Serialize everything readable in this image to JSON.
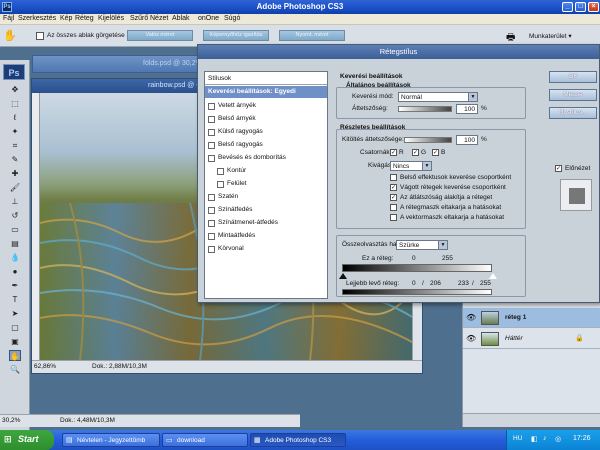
{
  "window": {
    "title": "Adobe Photoshop CS3",
    "app_badge": "Ps"
  },
  "menu": [
    "Fájl",
    "Szerkesztés",
    "Kép",
    "Réteg",
    "Kijelölés",
    "Szűrő",
    "Nézet",
    "Ablak",
    "onOne",
    "Súgó"
  ],
  "options": {
    "scroll_all_label": "Az összes ablak görgetése",
    "btn1": "Valós méret",
    "btn2": "Képernyőhöz igazítás",
    "btn3": "Nyomt. méret",
    "workspace": "Munkaterület ▾"
  },
  "documents": {
    "back_title": "földs.psd @ 30,2%",
    "front_title": "rainbow.psd @ 62,9%",
    "front_zoom": "62,86%",
    "front_dok": "Dok.: 2,88M/10,3M",
    "back_zoom": "30,2%",
    "back_dok": "Dok.: 4,48M/10,3M"
  },
  "dialog": {
    "title": "Rétegstílus",
    "list_header": "Stílusok",
    "list_selected": "Keverési beállítások: Egyedi",
    "styles": [
      "Vetett árnyék",
      "Belső árnyék",
      "Külső ragyogás",
      "Belső ragyogás",
      "Bevésés és domborítás",
      "Kontúr",
      "Felület",
      "Szatén",
      "Színátfedés",
      "Színátmenet-átfedés",
      "Mintaátfedés",
      "Körvonal"
    ],
    "blend_title": "Keverési beállítások",
    "general_title": "Általános beállítások",
    "blend_mode_label": "Keverési mód:",
    "blend_mode_value": "Normál",
    "opacity_label": "Áttetszőség:",
    "opacity_value": "100",
    "pct": "%",
    "advanced_title": "Részletes beállítások",
    "fill_label": "Kitöltés áttetszősége:",
    "fill_value": "100",
    "channels_label": "Csatornák:",
    "ch_r": "R",
    "ch_g": "G",
    "ch_b": "B",
    "knockout_label": "Kivágás:",
    "knockout_value": "Nincs",
    "opt1": "Belső effektusok keverése csoportként",
    "opt2": "Vágott rétegek keverése csoportként",
    "opt3": "Az átlátszóság alakítja a réteget",
    "opt4": "A rétegmaszk eltakarja a hatásokat",
    "opt5": "A vektormaszk eltakarja a hatásokat",
    "blend_if_label": "Összeolvasztás ha:",
    "blend_if_value": "Szürke",
    "this_layer_label": "Ez a réteg:",
    "this_low": "0",
    "this_high": "255",
    "under_layer_label": "Lejjebb levő réteg:",
    "under_low": "0",
    "under_mid1": "206",
    "under_mid2": "233",
    "under_high": "255",
    "ok": "OK",
    "cancel": "Mégse",
    "new_style": "Új stílus...",
    "preview": "Előnézet"
  },
  "layers": [
    {
      "name": "réteg 1",
      "selected": true
    },
    {
      "name": "Háttér",
      "selected": false
    }
  ],
  "taskbar": {
    "start": "Start",
    "tasks": [
      "Névtelen - Jegyzettömb",
      "download",
      "Adobe Photoshop CS3"
    ],
    "lang": "HU",
    "clock": "17:26"
  }
}
